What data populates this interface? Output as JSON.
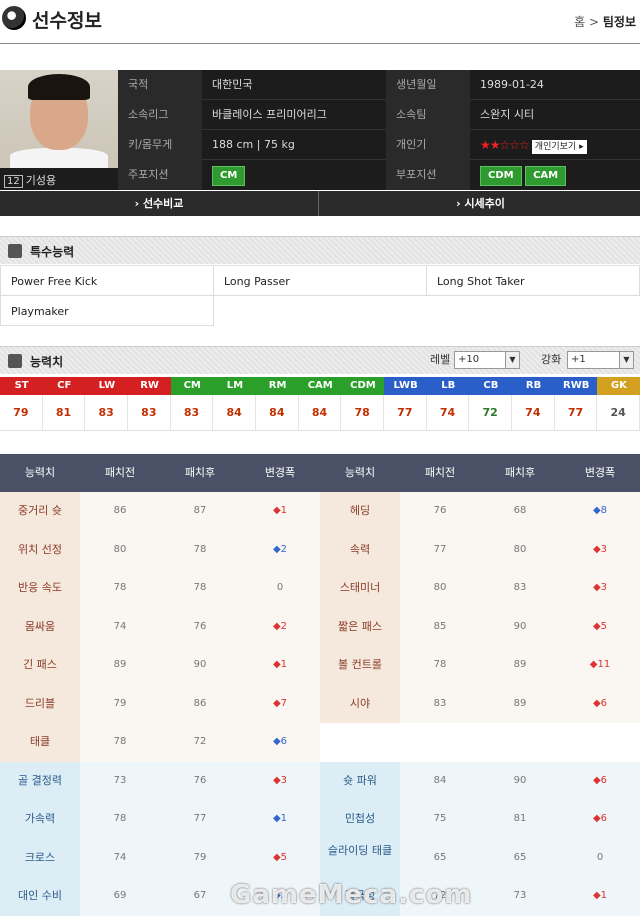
{
  "header": {
    "title": "선수정보",
    "breadcrumb_home": "홈",
    "breadcrumb_sep": ">",
    "breadcrumb_current": "팀정보"
  },
  "player": {
    "name": "기성용",
    "number": "12",
    "info": {
      "nation_label": "국적",
      "nation": "대한민국",
      "birth_label": "생년월일",
      "birth": "1989-01-24",
      "league_label": "소속리그",
      "league": "바클레이스 프리미어리그",
      "team_label": "소속팀",
      "team": "스완지 시티",
      "body_label": "키/몸무게",
      "body": "188 cm  |  75 kg",
      "popularity_label": "개인기",
      "popularity_stars": "★★☆☆☆",
      "skill_view": "개인기보기",
      "main_pos_label": "주포지션",
      "main_pos": [
        "CM"
      ],
      "sub_pos_label": "부포지션",
      "sub_pos": [
        "CDM",
        "CAM"
      ]
    }
  },
  "nav": {
    "compare": "› 선수비교",
    "price": "› 시세추이"
  },
  "special": {
    "title": "특수능력",
    "items": [
      "Power Free Kick",
      "Long Passer",
      "Long Shot Taker",
      "Playmaker"
    ]
  },
  "ability": {
    "title": "능력치",
    "level_label": "레벨",
    "level_value": "+10",
    "enhance_label": "강화",
    "enhance_value": "+1",
    "positions": [
      {
        "pos": "ST",
        "val": "79",
        "bg": "#d42020",
        "fg": "#c03000"
      },
      {
        "pos": "CF",
        "val": "81",
        "bg": "#d42020",
        "fg": "#c03000"
      },
      {
        "pos": "LW",
        "val": "83",
        "bg": "#d42020",
        "fg": "#c03000"
      },
      {
        "pos": "RW",
        "val": "83",
        "bg": "#d42020",
        "fg": "#c03000"
      },
      {
        "pos": "CM",
        "val": "83",
        "bg": "#2aa02a",
        "fg": "#c03000"
      },
      {
        "pos": "LM",
        "val": "84",
        "bg": "#2aa02a",
        "fg": "#c03000"
      },
      {
        "pos": "RM",
        "val": "84",
        "bg": "#2aa02a",
        "fg": "#c03000"
      },
      {
        "pos": "CAM",
        "val": "84",
        "bg": "#2aa02a",
        "fg": "#c03000"
      },
      {
        "pos": "CDM",
        "val": "78",
        "bg": "#2aa02a",
        "fg": "#c03000"
      },
      {
        "pos": "LWB",
        "val": "77",
        "bg": "#2a5ec8",
        "fg": "#c03000"
      },
      {
        "pos": "LB",
        "val": "74",
        "bg": "#2a5ec8",
        "fg": "#c03000"
      },
      {
        "pos": "CB",
        "val": "72",
        "bg": "#2a5ec8",
        "fg": "#2a7a2a"
      },
      {
        "pos": "RB",
        "val": "74",
        "bg": "#2a5ec8",
        "fg": "#c03000"
      },
      {
        "pos": "RWB",
        "val": "77",
        "bg": "#2a5ec8",
        "fg": "#c03000"
      },
      {
        "pos": "GK",
        "val": "24",
        "bg": "#d4a020",
        "fg": "#555"
      }
    ]
  },
  "table": {
    "headers": [
      "능력치",
      "패치전",
      "패치후",
      "변경폭",
      "능력치",
      "패치전",
      "패치후",
      "변경폭"
    ],
    "rows": [
      {
        "g": "w",
        "l": [
          "중거리 슛",
          "86",
          "87",
          "◆1",
          "dn"
        ],
        "r": [
          "헤딩",
          "76",
          "68",
          "◆8",
          "up"
        ]
      },
      {
        "g": "w",
        "l": [
          "위치 선정",
          "80",
          "78",
          "◆2",
          "up"
        ],
        "r": [
          "속력",
          "77",
          "80",
          "◆3",
          "dn"
        ]
      },
      {
        "g": "w",
        "l": [
          "반응 속도",
          "78",
          "78",
          "0",
          ""
        ],
        "r": [
          "스태미너",
          "80",
          "83",
          "◆3",
          "dn"
        ]
      },
      {
        "g": "w",
        "l": [
          "몸싸움",
          "74",
          "76",
          "◆2",
          "dn"
        ],
        "r": [
          "짧은 패스",
          "85",
          "90",
          "◆5",
          "dn"
        ]
      },
      {
        "g": "w",
        "l": [
          "긴 패스",
          "89",
          "90",
          "◆1",
          "dn"
        ],
        "r": [
          "볼 컨트롤",
          "78",
          "89",
          "◆11",
          "dn"
        ]
      },
      {
        "g": "w",
        "l": [
          "드리블",
          "79",
          "86",
          "◆7",
          "dn"
        ],
        "r": [
          "시야",
          "83",
          "89",
          "◆6",
          "dn"
        ]
      },
      {
        "g": "w",
        "l": [
          "태클",
          "78",
          "72",
          "◆6",
          "up"
        ],
        "r": null
      },
      {
        "g": "c",
        "l": [
          "골 결정력",
          "73",
          "76",
          "◆3",
          "dn"
        ],
        "r": [
          "슛 파워",
          "84",
          "90",
          "◆6",
          "dn"
        ]
      },
      {
        "g": "c",
        "l": [
          "가속력",
          "78",
          "77",
          "◆1",
          "up"
        ],
        "r": [
          "민첩성",
          "75",
          "81",
          "◆6",
          "dn"
        ]
      },
      {
        "g": "c",
        "l": [
          "크로스",
          "74",
          "79",
          "◆5",
          "dn"
        ],
        "r": [
          "슬라이딩 태클",
          "65",
          "65",
          "0",
          ""
        ]
      },
      {
        "g": "c",
        "l": [
          "대인 수비",
          "69",
          "67",
          "◆2",
          "up"
        ],
        "r": [
          "적극성",
          "72",
          "73",
          "◆1",
          "dn"
        ]
      }
    ]
  },
  "watermark": "GameMeca.com"
}
